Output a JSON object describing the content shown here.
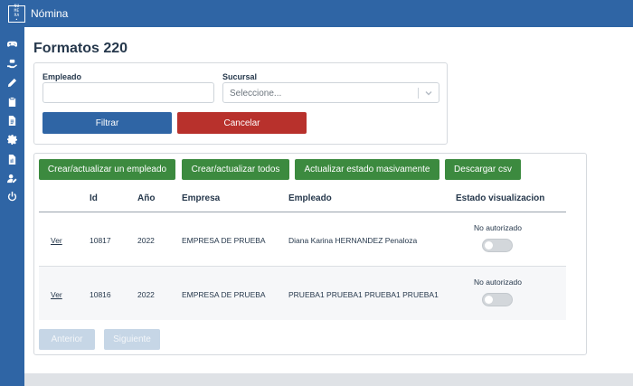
{
  "app": {
    "logo_lines": [
      "NU",
      "ME",
      "RA",
      "•"
    ],
    "title": "Nómina"
  },
  "sidebar": {
    "items": [
      {
        "icon": "gamepad-icon"
      },
      {
        "icon": "hand-coins-icon"
      },
      {
        "icon": "pencil-icon"
      },
      {
        "icon": "clipboard-icon"
      },
      {
        "icon": "document-icon"
      },
      {
        "icon": "gear-icon"
      },
      {
        "icon": "file-chart-icon"
      },
      {
        "icon": "user-edit-icon"
      },
      {
        "icon": "power-icon"
      }
    ]
  },
  "page": {
    "title": "Formatos 220"
  },
  "filters": {
    "employee_label": "Empleado",
    "employee_value": "",
    "branch_label": "Sucursal",
    "branch_placeholder": "Seleccione...",
    "filter_button": "Filtrar",
    "cancel_button": "Cancelar"
  },
  "actions": {
    "create_one": "Crear/actualizar un empleado",
    "create_all": "Crear/actualizar todos",
    "bulk_update": "Actualizar estado masivamente",
    "download_csv": "Descargar csv"
  },
  "table": {
    "columns": [
      "Id",
      "Año",
      "Empresa",
      "Empleado",
      "Estado visualizacion"
    ],
    "rows": [
      {
        "link": "Ver",
        "id": "10817",
        "year": "2022",
        "company": "EMPRESA DE PRUEBA",
        "employee": "Diana Karina HERNANDEZ Penaloza",
        "status": "No autorizado",
        "toggle_on": false
      },
      {
        "link": "Ver",
        "id": "10816",
        "year": "2022",
        "company": "EMPRESA DE PRUEBA",
        "employee": "PRUEBA1 PRUEBA1 PRUEBA1 PRUEBA1",
        "status": "No autorizado",
        "toggle_on": false
      }
    ]
  },
  "pagination": {
    "prev": "Anterior",
    "next": "Siguiente"
  },
  "colors": {
    "primary": "#2f65a5",
    "danger": "#b8312c",
    "success": "#3c8a3f"
  }
}
